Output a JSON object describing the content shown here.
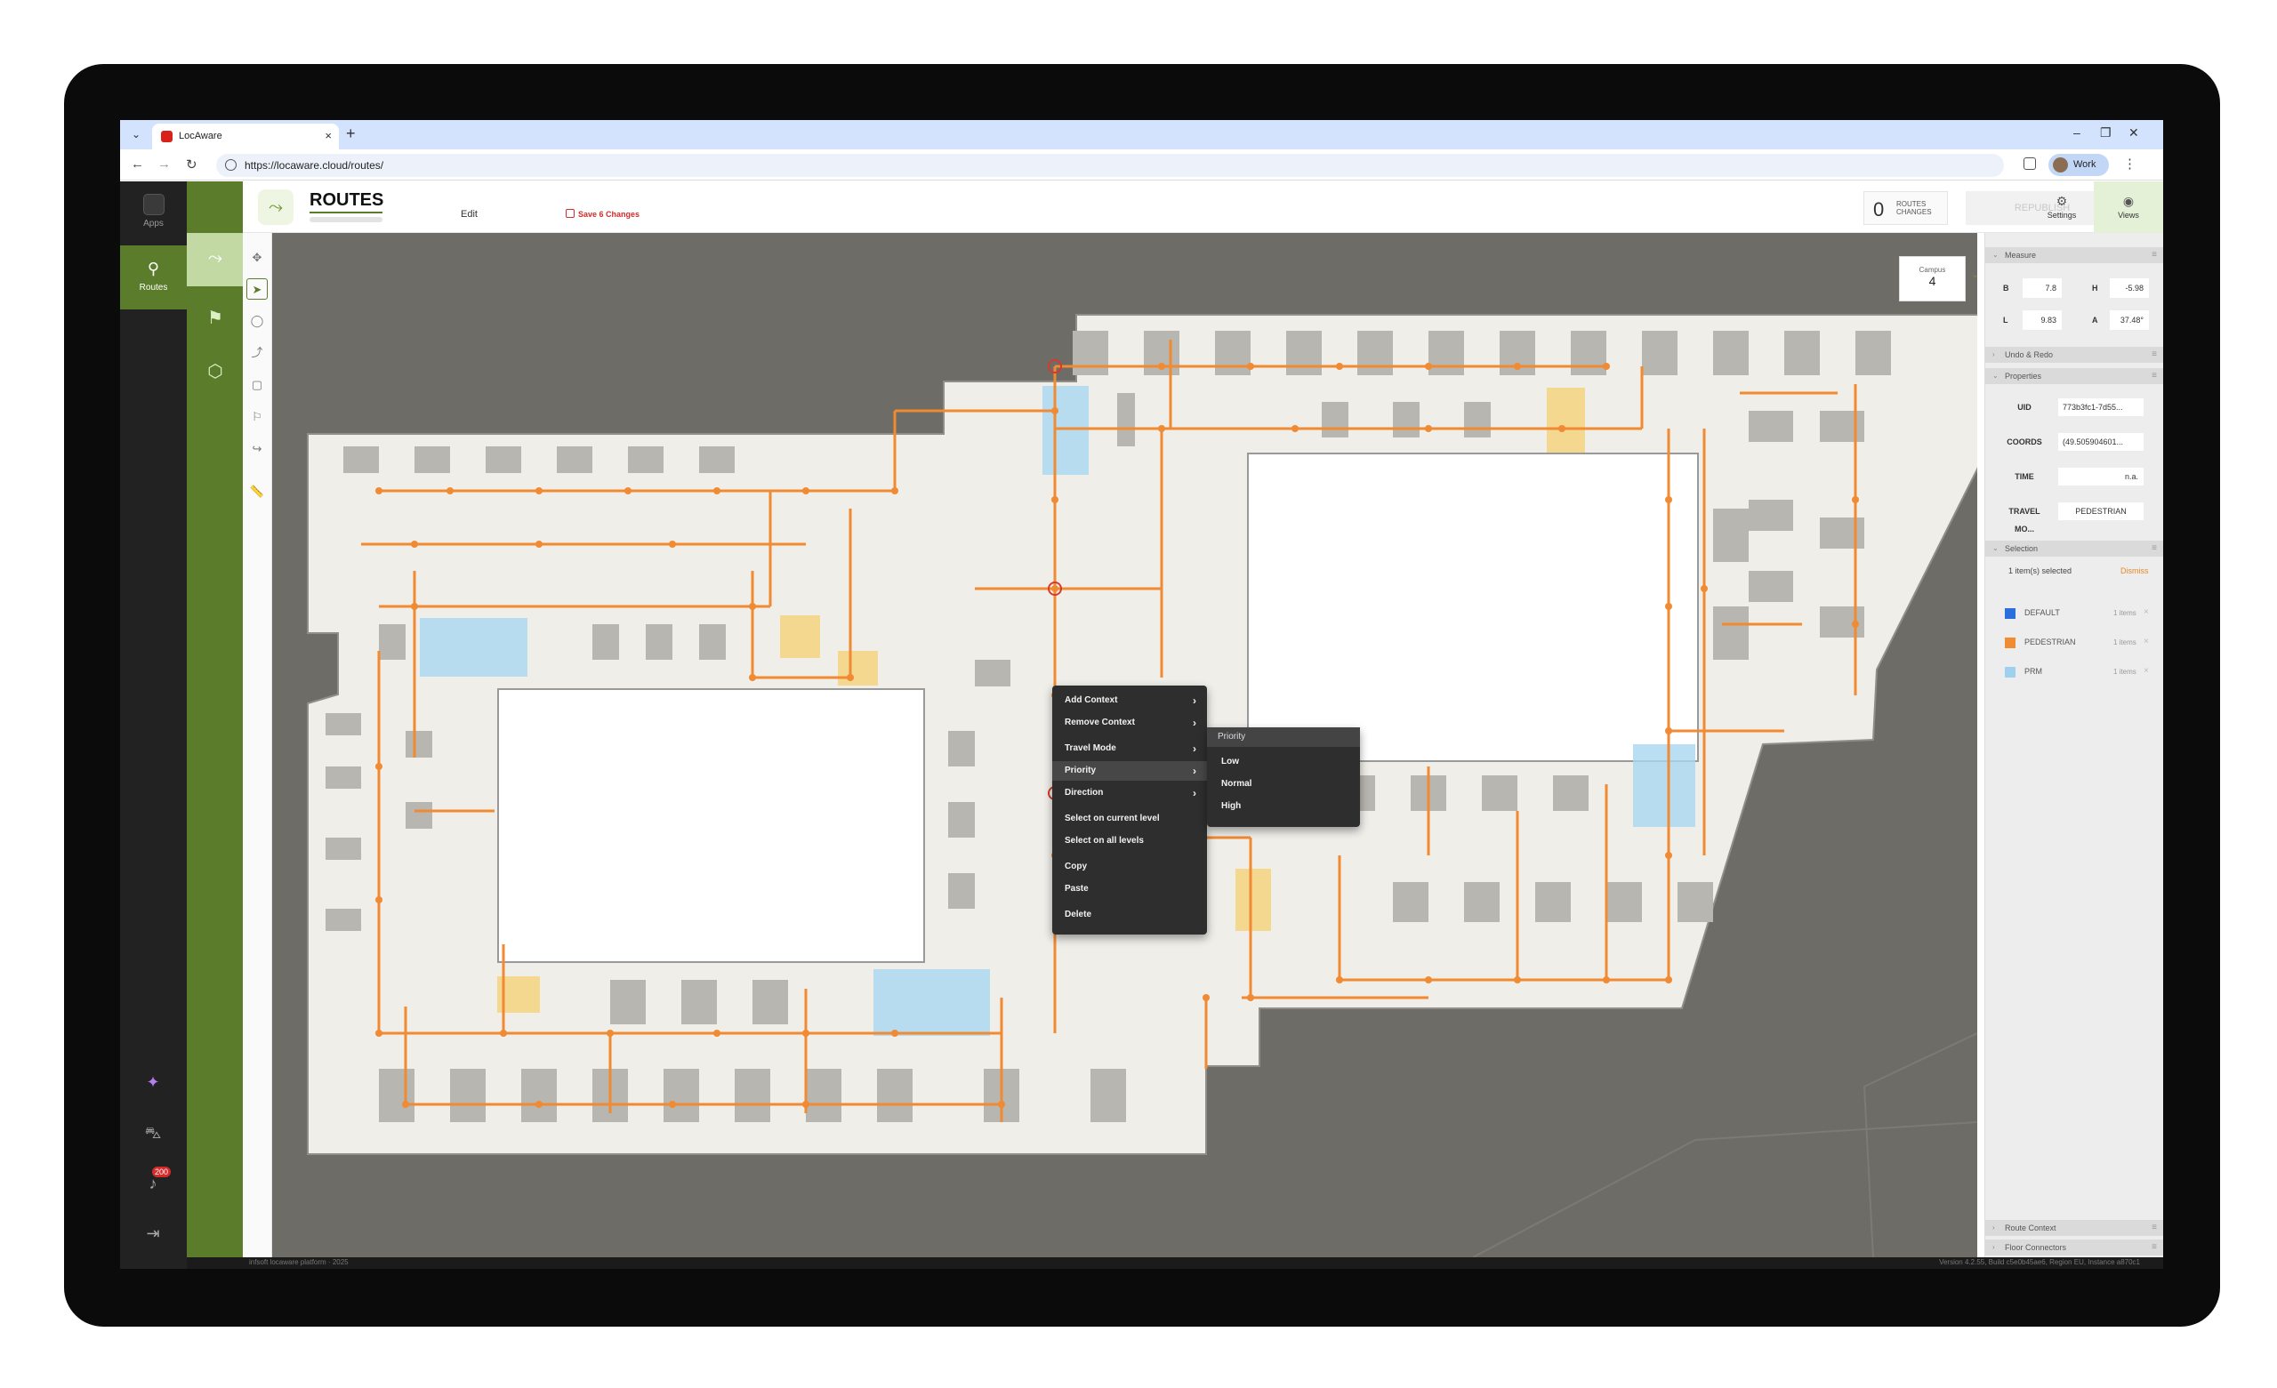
{
  "browser": {
    "tab_title": "LocAware",
    "url": "https://locaware.cloud/routes/",
    "profile_label": "Work"
  },
  "leftnav": {
    "items": [
      {
        "label": "Apps",
        "icon": "apps-icon"
      },
      {
        "label": "Routes",
        "icon": "routes-icon"
      }
    ],
    "notification_count": "200"
  },
  "header": {
    "title": "ROUTES",
    "edit_label": "Edit",
    "save_label": "Save 6 Changes",
    "routes_changes_count": "0",
    "routes_changes_label": "ROUTES CHANGES",
    "republish_label": "REPUBLISH",
    "settings_label": "Settings",
    "views_label": "Views"
  },
  "campus": {
    "label": "Campus",
    "value": "4"
  },
  "context_menu": {
    "items": [
      {
        "label": "Add Context",
        "submenu": true
      },
      {
        "label": "Remove Context",
        "submenu": true
      },
      {
        "label": "Travel Mode",
        "submenu": true
      },
      {
        "label": "Priority",
        "submenu": true
      },
      {
        "label": "Direction",
        "submenu": true
      },
      {
        "label": "Select on current level",
        "submenu": false
      },
      {
        "label": "Select on all levels",
        "submenu": false
      },
      {
        "label": "Copy",
        "submenu": false
      },
      {
        "label": "Paste",
        "submenu": false
      },
      {
        "label": "Delete",
        "submenu": false
      }
    ],
    "submenu": {
      "title": "Priority",
      "items": [
        "Low",
        "Normal",
        "High"
      ]
    }
  },
  "panel": {
    "measure": {
      "title": "Measure",
      "B": "7.8",
      "H": "-5.98",
      "L": "9.83",
      "A": "37.48°"
    },
    "undo_redo_title": "Undo & Redo",
    "properties": {
      "title": "Properties",
      "uid_label": "UID",
      "uid_value": "773b3fc1-7d55...",
      "coords_label": "COORDS",
      "coords_value": "(49.505904601...",
      "time_label": "TIME",
      "time_value": "n.a.",
      "travel_label": "TRAVEL MO...",
      "travel_value": "PEDESTRIAN"
    },
    "selection": {
      "title": "Selection",
      "count_text": "1 item(s) selected",
      "dismiss_label": "Dismiss",
      "layers": [
        {
          "name": "DEFAULT",
          "count": "1 items",
          "color": "#2a6fdc"
        },
        {
          "name": "PEDESTRIAN",
          "count": "1 items",
          "color": "#f08a33"
        },
        {
          "name": "PRM",
          "count": "1 items",
          "color": "#9fd0f0"
        }
      ]
    },
    "route_context_title": "Route Context",
    "floor_connectors_title": "Floor Connectors"
  },
  "footer": {
    "left": "infsoft locaware platform · 2025",
    "right": "Version 4.2.55, Build c5e0b45ae6, Region EU, Instance a870c1"
  },
  "colors": {
    "brand_green": "#5b7d2b",
    "route_orange": "#f08a33",
    "map_bg": "#6e6c66"
  }
}
